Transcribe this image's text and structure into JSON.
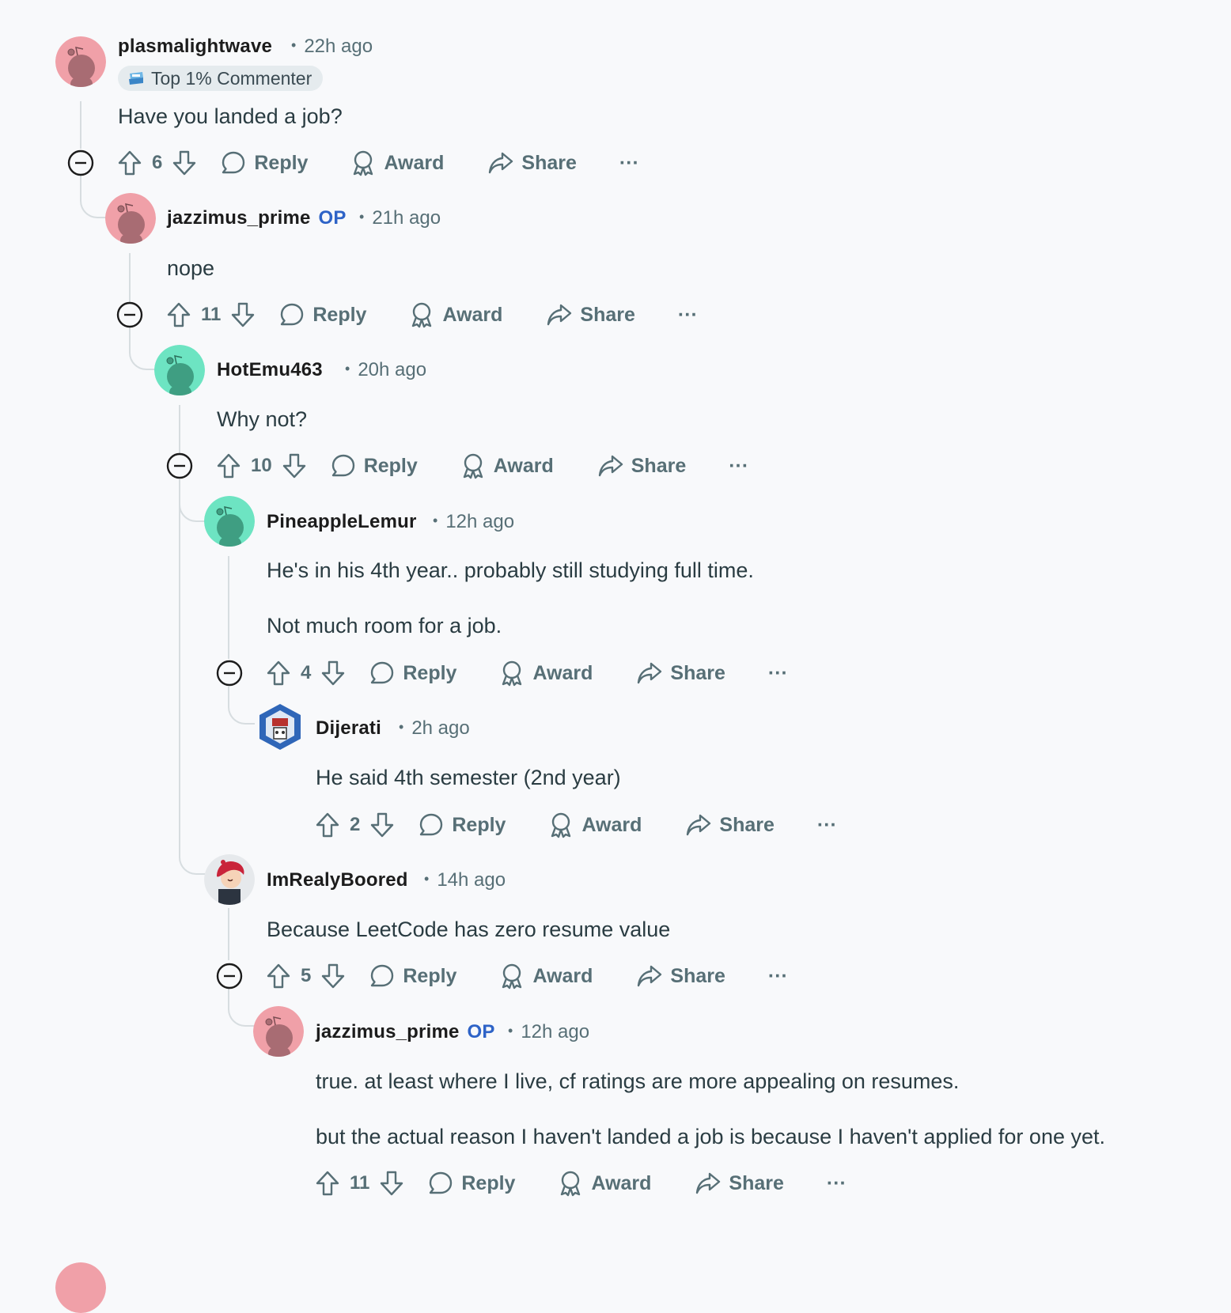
{
  "comments": [
    {
      "username": "plasmalightwave",
      "op_badge": "",
      "time": "22h ago",
      "flair": "Top 1% Commenter",
      "body": [
        "Have you landed a job?"
      ],
      "votes": "6",
      "avatar_color": "#f0a0a8",
      "avatar_icon": "snoo-avatar"
    },
    {
      "username": "jazzimus_prime",
      "op_badge": "OP",
      "time": "21h ago",
      "body": [
        "nope"
      ],
      "votes": "11",
      "avatar_color": "#f0a0a8",
      "avatar_icon": "snoo-avatar"
    },
    {
      "username": "HotEmu463",
      "op_badge": "",
      "time": "20h ago",
      "body": [
        "Why not?"
      ],
      "votes": "10",
      "avatar_color": "#6de4c2",
      "avatar_icon": "snoo-avatar"
    },
    {
      "username": "PineappleLemur",
      "op_badge": "",
      "time": "12h ago",
      "body": [
        "He's in his 4th year.. probably still studying full time.",
        "Not much room for a job."
      ],
      "votes": "4",
      "avatar_color": "#6de4c2",
      "avatar_icon": "snoo-avatar"
    },
    {
      "username": "Dijerati",
      "op_badge": "",
      "time": "2h ago",
      "body": [
        "He said 4th semester (2nd year)"
      ],
      "votes": "2",
      "avatar_color": "#3a6fc4",
      "avatar_icon": "custom-avatar"
    },
    {
      "username": "ImRealyBoored",
      "op_badge": "",
      "time": "14h ago",
      "body": [
        "Because LeetCode has zero resume value"
      ],
      "votes": "5",
      "avatar_color": "#e6e9ec",
      "avatar_icon": "custom-avatar"
    },
    {
      "username": "jazzimus_prime",
      "op_badge": "OP",
      "time": "12h ago",
      "body": [
        "true. at least where I live, cf ratings are more appealing on resumes.",
        "but the actual reason I haven't landed a job is because I haven't applied for one yet."
      ],
      "votes": "11",
      "avatar_color": "#f0a0a8",
      "avatar_icon": "snoo-avatar"
    }
  ],
  "actions": {
    "reply": "Reply",
    "award": "Award",
    "share": "Share",
    "more": "···"
  },
  "colors": {
    "op": "#2e63c7",
    "meta": "#576f76",
    "thread_line": "#d7dde0",
    "background": "#f8f9fb"
  }
}
